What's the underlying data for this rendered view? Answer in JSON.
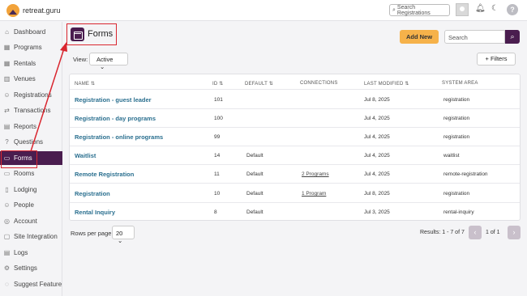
{
  "app": {
    "logo_text": "retreat.guru"
  },
  "topbar": {
    "search_placeholder": "Search Registrations"
  },
  "sidebar": {
    "items": [
      {
        "label": "Dashboard",
        "icon": "home-icon"
      },
      {
        "label": "Programs",
        "icon": "calendar-icon"
      },
      {
        "label": "Rentals",
        "icon": "calendar-icon"
      },
      {
        "label": "Venues",
        "icon": "building-icon"
      },
      {
        "label": "Registrations",
        "icon": "users-icon"
      },
      {
        "label": "Transactions",
        "icon": "exchange-icon"
      },
      {
        "label": "Reports",
        "icon": "chart-icon"
      },
      {
        "label": "Questions",
        "icon": "question-icon"
      },
      {
        "label": "Forms",
        "icon": "form-icon",
        "active": true
      },
      {
        "label": "Rooms",
        "icon": "bed-icon"
      },
      {
        "label": "Lodging",
        "icon": "lodging-icon"
      },
      {
        "label": "People",
        "icon": "person-icon"
      },
      {
        "label": "Account",
        "icon": "account-icon"
      },
      {
        "label": "Site Integration",
        "icon": "integration-icon"
      },
      {
        "label": "Logs",
        "icon": "logs-icon"
      },
      {
        "label": "Settings",
        "icon": "gear-icon"
      },
      {
        "label": "Suggest Feature",
        "icon": "bulb-icon"
      }
    ]
  },
  "page": {
    "title": "Forms",
    "add_new_label": "Add New",
    "search_placeholder": "Search",
    "view_label": "View:",
    "view_value": "Active",
    "filters_label": "Filters"
  },
  "table": {
    "columns": [
      "NAME",
      "ID",
      "DEFAULT",
      "CONNECTIONS",
      "LAST MODIFIED",
      "SYSTEM AREA"
    ],
    "rows": [
      {
        "name": "Registration - guest leader",
        "id": "101",
        "default": "",
        "connections": "",
        "modified": "Jul 8, 2025",
        "area": "registration"
      },
      {
        "name": "Registration - day programs",
        "id": "100",
        "default": "",
        "connections": "",
        "modified": "Jul 4, 2025",
        "area": "registration"
      },
      {
        "name": "Registration - online programs",
        "id": "99",
        "default": "",
        "connections": "",
        "modified": "Jul 4, 2025",
        "area": "registration"
      },
      {
        "name": "Waitlist",
        "id": "14",
        "default": "Default",
        "connections": "",
        "modified": "Jul 4, 2025",
        "area": "waitlist"
      },
      {
        "name": "Remote Registration",
        "id": "11",
        "default": "Default",
        "connections": "2 Programs",
        "modified": "Jul 4, 2025",
        "area": "remote-registration"
      },
      {
        "name": "Registration",
        "id": "10",
        "default": "Default",
        "connections": "1 Program",
        "modified": "Jul 8, 2025",
        "area": "registration"
      },
      {
        "name": "Rental Inquiry",
        "id": "8",
        "default": "Default",
        "connections": "",
        "modified": "Jul 3, 2025",
        "area": "rental-inquiry"
      }
    ]
  },
  "pagination": {
    "rows_per_page_label": "Rows per page:",
    "rows_per_page_value": "20",
    "results_text": "Results: 1 - 7 of 7",
    "page_text": "1 of 1"
  },
  "colors": {
    "brand": "#4a1d4f",
    "accent": "#f6b24a",
    "highlight": "#d9262f",
    "link": "#2a6f8f"
  }
}
